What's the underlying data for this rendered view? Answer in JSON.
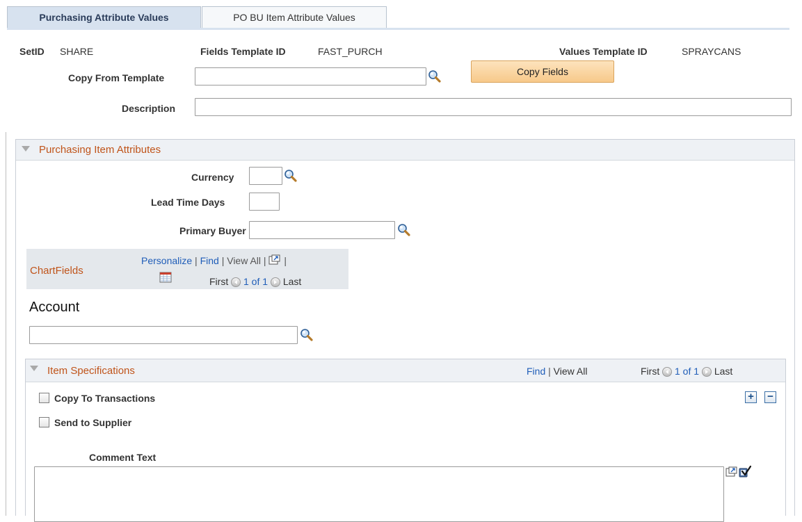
{
  "tabs": [
    {
      "label": "Purchasing Attribute Values"
    },
    {
      "label": "PO BU Item Attribute Values"
    }
  ],
  "header": {
    "setid_label": "SetID",
    "setid_value": "SHARE",
    "fields_template_label": "Fields Template ID",
    "fields_template_value": "FAST_PURCH",
    "values_template_label": "Values Template ID",
    "values_template_value": "SPRAYCANS",
    "copy_from_label": "Copy From Template",
    "copy_from_value": "",
    "copy_fields_button": "Copy Fields",
    "description_label": "Description",
    "description_value": ""
  },
  "purchasing": {
    "title": "Purchasing Item Attributes",
    "currency_label": "Currency",
    "currency_value": "",
    "lead_time_label": "Lead Time Days",
    "lead_time_value": "",
    "buyer_label": "Primary Buyer",
    "buyer_value": ""
  },
  "chartfields": {
    "title": "ChartFields",
    "personalize": "Personalize",
    "find": "Find",
    "view_all": "View All",
    "first": "First",
    "count": "1 of 1",
    "last": "Last",
    "account_label": "Account",
    "account_value": ""
  },
  "item_specs": {
    "title": "Item Specifications",
    "find": "Find",
    "view_all": "View All",
    "first": "First",
    "count": "1 of 1",
    "last": "Last",
    "copy_to_transactions": "Copy To Transactions",
    "send_to_supplier": "Send to Supplier",
    "comment_label": "Comment Text",
    "comment_value": ""
  },
  "colors": {
    "accent": "#c0541a",
    "link": "#1f5db8",
    "tab_active_bg": "#d7e2ef",
    "button_bg": "#f7c98a"
  },
  "icons": [
    "search-icon",
    "new-window-icon",
    "grid-icon",
    "previous-icon",
    "next-icon",
    "spell-check-icon",
    "add-row-icon",
    "delete-row-icon",
    "collapse-triangle-icon"
  ]
}
